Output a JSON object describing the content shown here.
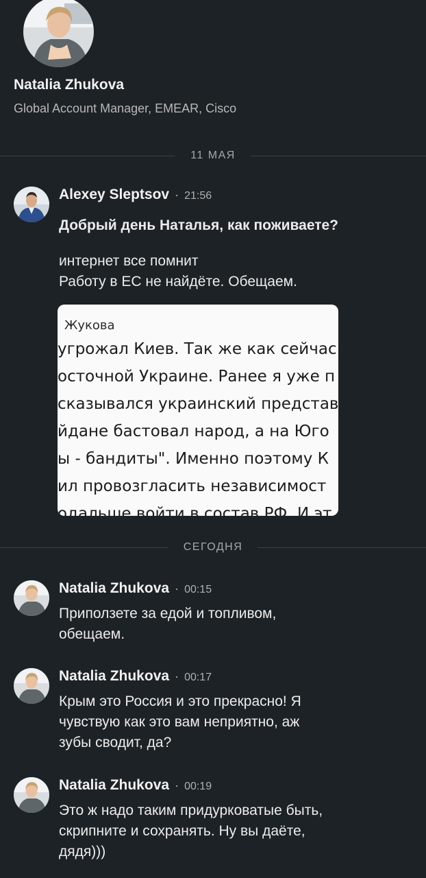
{
  "profile": {
    "name": "Natalia Zhukova",
    "headline": "Global Account Manager, EMEAR, Cisco"
  },
  "dividers": {
    "first": "11 МАЯ",
    "second": "СЕГОДНЯ"
  },
  "messages": [
    {
      "sender": "Alexey Sleptsov",
      "time": "21:56",
      "lines": [
        "Добрый день Наталья, как поживаете?",
        "интернет все помнит",
        "Работу в ЕС не найдёте. Обещаем."
      ]
    },
    {
      "sender": "Natalia Zhukova",
      "time": "00:15",
      "lines": [
        "Приползете за едой и топливом,",
        "обещаем."
      ]
    },
    {
      "sender": "Natalia Zhukova",
      "time": "00:17",
      "lines": [
        "Крым это Россия и это прекрасно! Я",
        "чувствую как это вам неприятно, аж",
        "зубы сводит, да?"
      ]
    },
    {
      "sender": "Natalia Zhukova",
      "time": "00:19",
      "lines": [
        "Это ж надо таким придурковатые быть,",
        "скрипните и сохранять. Ну вы даёте,",
        "дядя)))"
      ]
    }
  ],
  "attachment": {
    "author": "Жукова",
    "lines": [
      "угрожал Киев. Так же как сейчас",
      "осточной Украине. Ранее я уже п",
      "сказывался украинский представ",
      "йдане бастовал народ, а на Юго",
      "ы - бандиты\". Именно поэтому К",
      "ил провозгласить независимост",
      "одальше войти в состав РФ. И эт"
    ]
  },
  "colors": {
    "background": "#1d2226",
    "divider_line": "#3b4146",
    "secondary_text": "#b0b0b0"
  }
}
